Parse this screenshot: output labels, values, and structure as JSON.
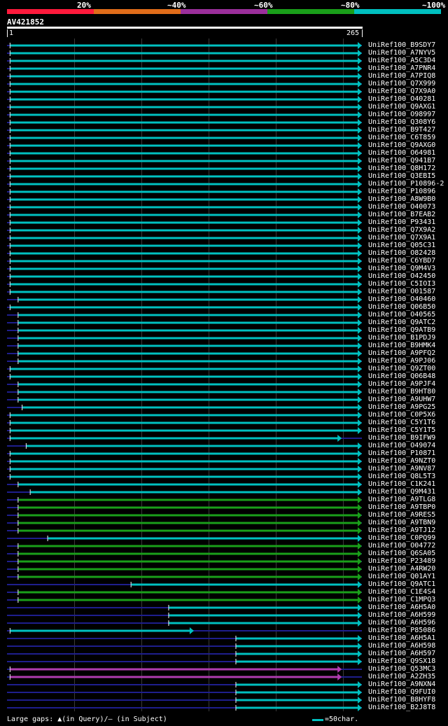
{
  "legend": [
    {
      "label": "20%",
      "color": "#ff1a3c"
    },
    {
      "label": "~40%",
      "color": "#e06c1a"
    },
    {
      "label": "~60%",
      "color": "#9b2f9b"
    },
    {
      "label": "~80%",
      "color": "#1a9f1a"
    },
    {
      "label": "~100%",
      "color": "#00c0c0"
    }
  ],
  "query": {
    "name": "AV421852",
    "start": "1",
    "end": "265"
  },
  "colors": {
    "cyan": "#00c0c0",
    "green": "#1a9f1a",
    "purple": "#b03cb0",
    "gap": "#1e1e8c",
    "grid": "#3a3a3a"
  },
  "hits": [
    {
      "name": "UniRef100_B9SDY7",
      "start": 3,
      "end": 265,
      "color": "cyan"
    },
    {
      "name": "UniRef100_A7NYV5",
      "start": 3,
      "end": 265,
      "color": "cyan"
    },
    {
      "name": "UniRef100_A5C3D4",
      "start": 3,
      "end": 265,
      "color": "cyan"
    },
    {
      "name": "UniRef100_A7PNR4",
      "start": 3,
      "end": 265,
      "color": "cyan"
    },
    {
      "name": "UniRef100_A7PIQ8",
      "start": 3,
      "end": 265,
      "color": "cyan"
    },
    {
      "name": "UniRef100_Q7X999",
      "start": 3,
      "end": 265,
      "color": "cyan"
    },
    {
      "name": "UniRef100_Q7X9A0",
      "start": 3,
      "end": 265,
      "color": "cyan"
    },
    {
      "name": "UniRef100_O40281",
      "start": 3,
      "end": 265,
      "color": "cyan"
    },
    {
      "name": "UniRef100_Q9AXG1",
      "start": 3,
      "end": 265,
      "color": "cyan"
    },
    {
      "name": "UniRef100_O98997",
      "start": 3,
      "end": 265,
      "color": "cyan"
    },
    {
      "name": "UniRef100_Q308Y6",
      "start": 3,
      "end": 265,
      "color": "cyan"
    },
    {
      "name": "UniRef100_B9T427",
      "start": 3,
      "end": 265,
      "color": "cyan"
    },
    {
      "name": "UniRef100_C6T859",
      "start": 3,
      "end": 265,
      "color": "cyan"
    },
    {
      "name": "UniRef100_Q9AXG0",
      "start": 3,
      "end": 265,
      "color": "cyan"
    },
    {
      "name": "UniRef100_O64981",
      "start": 3,
      "end": 265,
      "color": "cyan"
    },
    {
      "name": "UniRef100_Q941B7",
      "start": 3,
      "end": 265,
      "color": "cyan"
    },
    {
      "name": "UniRef100_Q8H172",
      "start": 3,
      "end": 265,
      "color": "cyan"
    },
    {
      "name": "UniRef100_Q3EBI5",
      "start": 3,
      "end": 265,
      "color": "cyan"
    },
    {
      "name": "UniRef100_P10896-2",
      "start": 3,
      "end": 265,
      "color": "cyan"
    },
    {
      "name": "UniRef100_P10896",
      "start": 3,
      "end": 265,
      "color": "cyan"
    },
    {
      "name": "UniRef100_A8W9B0",
      "start": 3,
      "end": 265,
      "color": "cyan"
    },
    {
      "name": "UniRef100_O40073",
      "start": 3,
      "end": 265,
      "color": "cyan"
    },
    {
      "name": "UniRef100_B7EAB2",
      "start": 3,
      "end": 265,
      "color": "cyan"
    },
    {
      "name": "UniRef100_P93431",
      "start": 3,
      "end": 265,
      "color": "cyan"
    },
    {
      "name": "UniRef100_Q7X9A2",
      "start": 3,
      "end": 265,
      "color": "cyan"
    },
    {
      "name": "UniRef100_Q7X9A1",
      "start": 3,
      "end": 265,
      "color": "cyan"
    },
    {
      "name": "UniRef100_Q05C31",
      "start": 3,
      "end": 265,
      "color": "cyan"
    },
    {
      "name": "UniRef100_O82428",
      "start": 3,
      "end": 265,
      "color": "cyan"
    },
    {
      "name": "UniRef100_C6YBD7",
      "start": 3,
      "end": 265,
      "color": "cyan"
    },
    {
      "name": "UniRef100_Q9M4V3",
      "start": 3,
      "end": 265,
      "color": "cyan"
    },
    {
      "name": "UniRef100_O42450",
      "start": 3,
      "end": 265,
      "color": "cyan"
    },
    {
      "name": "UniRef100_C5IOI3",
      "start": 3,
      "end": 265,
      "color": "cyan"
    },
    {
      "name": "UniRef100_O01587",
      "start": 3,
      "end": 265,
      "color": "cyan"
    },
    {
      "name": "UniRef100_O40460",
      "start": 9,
      "end": 265,
      "color": "cyan"
    },
    {
      "name": "UniRef100_Q06B50",
      "start": 3,
      "end": 265,
      "color": "cyan"
    },
    {
      "name": "UniRef100_O40565",
      "start": 9,
      "end": 265,
      "color": "cyan"
    },
    {
      "name": "UniRef100_Q9ATC2",
      "start": 9,
      "end": 265,
      "color": "cyan"
    },
    {
      "name": "UniRef100_Q9ATB9",
      "start": 9,
      "end": 265,
      "color": "cyan"
    },
    {
      "name": "UniRef100_B1PDJ9",
      "start": 9,
      "end": 265,
      "color": "cyan"
    },
    {
      "name": "UniRef100_B9HMK4",
      "start": 9,
      "end": 265,
      "color": "cyan"
    },
    {
      "name": "UniRef100_A9PFQ2",
      "start": 9,
      "end": 265,
      "color": "cyan"
    },
    {
      "name": "UniRef100_A9PJ06",
      "start": 9,
      "end": 265,
      "color": "cyan"
    },
    {
      "name": "UniRef100_Q9ZT00",
      "start": 3,
      "end": 265,
      "color": "cyan"
    },
    {
      "name": "UniRef100_Q06B48",
      "start": 3,
      "end": 265,
      "color": "cyan"
    },
    {
      "name": "UniRef100_A9PJF4",
      "start": 9,
      "end": 265,
      "color": "cyan"
    },
    {
      "name": "UniRef100_B9HT80",
      "start": 9,
      "end": 265,
      "color": "cyan"
    },
    {
      "name": "UniRef100_A9UHW7",
      "start": 9,
      "end": 265,
      "color": "cyan"
    },
    {
      "name": "UniRef100_A9PG25",
      "start": 12,
      "end": 265,
      "color": "cyan"
    },
    {
      "name": "UniRef100_C0P5X6",
      "start": 3,
      "end": 265,
      "color": "cyan"
    },
    {
      "name": "UniRef100_C5Y1T6",
      "start": 3,
      "end": 265,
      "color": "cyan"
    },
    {
      "name": "UniRef100_C5Y1T5",
      "start": 3,
      "end": 265,
      "color": "cyan"
    },
    {
      "name": "UniRef100_B9IFW9",
      "start": 3,
      "end": 250,
      "color": "cyan"
    },
    {
      "name": "UniRef100_O49074",
      "start": 15,
      "end": 265,
      "color": "cyan"
    },
    {
      "name": "UniRef100_P10871",
      "start": 3,
      "end": 265,
      "color": "cyan"
    },
    {
      "name": "UniRef100_A9NZT0",
      "start": 3,
      "end": 265,
      "color": "cyan"
    },
    {
      "name": "UniRef100_A9NV87",
      "start": 3,
      "end": 265,
      "color": "cyan"
    },
    {
      "name": "UniRef100_Q8L5T3",
      "start": 3,
      "end": 265,
      "color": "cyan"
    },
    {
      "name": "UniRef100_C1K241",
      "start": 9,
      "end": 265,
      "color": "cyan"
    },
    {
      "name": "UniRef100_Q9M431",
      "start": 18,
      "end": 265,
      "color": "cyan"
    },
    {
      "name": "UniRef100_A9TLG8",
      "start": 9,
      "end": 265,
      "color": "green"
    },
    {
      "name": "UniRef100_A9TBP0",
      "start": 9,
      "end": 265,
      "color": "green"
    },
    {
      "name": "UniRef100_A9RES5",
      "start": 9,
      "end": 265,
      "color": "green"
    },
    {
      "name": "UniRef100_A9TBN9",
      "start": 9,
      "end": 265,
      "color": "green"
    },
    {
      "name": "UniRef100_A9TJ12",
      "start": 9,
      "end": 265,
      "color": "green"
    },
    {
      "name": "UniRef100_C0PQ99",
      "start": 31,
      "end": 265,
      "color": "cyan"
    },
    {
      "name": "UniRef100_O04772",
      "start": 9,
      "end": 265,
      "color": "green"
    },
    {
      "name": "UniRef100_Q6SA05",
      "start": 9,
      "end": 265,
      "color": "green"
    },
    {
      "name": "UniRef100_P23489",
      "start": 9,
      "end": 265,
      "color": "green"
    },
    {
      "name": "UniRef100_A4RW20",
      "start": 9,
      "end": 265,
      "color": "green"
    },
    {
      "name": "UniRef100_Q01AY1",
      "start": 9,
      "end": 265,
      "color": "green"
    },
    {
      "name": "UniRef100_Q9ATC1",
      "start": 93,
      "end": 265,
      "color": "cyan"
    },
    {
      "name": "UniRef100_C1E4S4",
      "start": 9,
      "end": 265,
      "color": "green"
    },
    {
      "name": "UniRef100_C1MPQ3",
      "start": 9,
      "end": 265,
      "color": "green"
    },
    {
      "name": "UniRef100_A6H5A0",
      "start": 121,
      "end": 265,
      "color": "cyan"
    },
    {
      "name": "UniRef100_A6H599",
      "start": 121,
      "end": 265,
      "color": "cyan"
    },
    {
      "name": "UniRef100_A6H596",
      "start": 121,
      "end": 265,
      "color": "cyan"
    },
    {
      "name": "UniRef100_P85086",
      "start": 3,
      "end": 140,
      "color": "cyan"
    },
    {
      "name": "UniRef100_A6H5A1",
      "start": 171,
      "end": 265,
      "color": "cyan"
    },
    {
      "name": "UniRef100_A6H598",
      "start": 171,
      "end": 265,
      "color": "cyan"
    },
    {
      "name": "UniRef100_A6H597",
      "start": 171,
      "end": 265,
      "color": "cyan"
    },
    {
      "name": "UniRef100_Q9SX18",
      "start": 171,
      "end": 265,
      "color": "cyan"
    },
    {
      "name": "UniRef100_Q53MC3",
      "start": 3,
      "end": 250,
      "color": "purple"
    },
    {
      "name": "UniRef100_A2ZH35",
      "start": 3,
      "end": 250,
      "color": "purple"
    },
    {
      "name": "UniRef100_A9NXN4",
      "start": 171,
      "end": 265,
      "color": "cyan"
    },
    {
      "name": "UniRef100_Q9FUI0",
      "start": 171,
      "end": 265,
      "color": "cyan"
    },
    {
      "name": "UniRef100_B8HYF8",
      "start": 171,
      "end": 265,
      "color": "cyan"
    },
    {
      "name": "UniRef100_B2J8T8",
      "start": 171,
      "end": 265,
      "color": "cyan"
    }
  ],
  "footer": {
    "gaps_text": "Large gaps: ▲(in Query)/– (in Subject)",
    "scale_text": "=50char."
  }
}
